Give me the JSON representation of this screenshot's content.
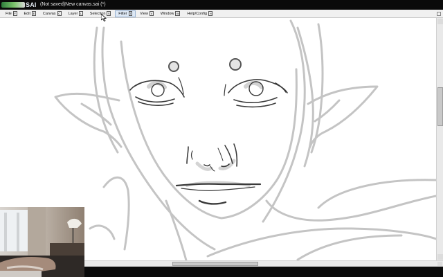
{
  "app": {
    "title": "(Not saved)New canvas.sai (*)",
    "logo_text": "SAI"
  },
  "menu": {
    "items": [
      {
        "label": "File",
        "key": "F"
      },
      {
        "label": "Edit",
        "key": "E"
      },
      {
        "label": "Canvas",
        "key": "C"
      },
      {
        "label": "Layer",
        "key": "L"
      },
      {
        "label": "Selection",
        "key": "S"
      },
      {
        "label": "Filter",
        "key": "T",
        "active": true
      },
      {
        "label": "View",
        "key": "V"
      },
      {
        "label": "Window",
        "key": "W"
      },
      {
        "label": "Help/Config",
        "key": "H"
      }
    ]
  },
  "canvas": {
    "background": "#ffffff",
    "sketch_dark": "#3a3a3a",
    "sketch_light": "#c4c4c4"
  },
  "webcam": {
    "description_icon": "webcam-feed"
  }
}
